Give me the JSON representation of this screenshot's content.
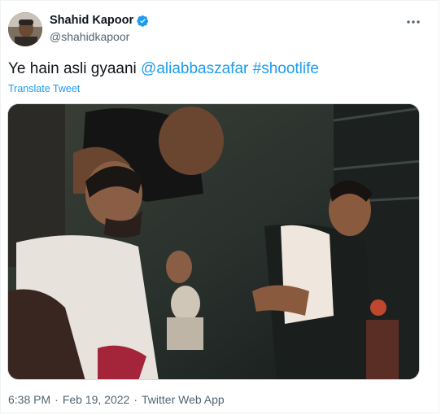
{
  "author": {
    "display_name": "Shahid Kapoor",
    "handle": "@shahidkapoor",
    "verified": true
  },
  "tweet": {
    "text_plain": "Ye hain asli gyaani ",
    "mentions": [
      "@aliabbaszafar"
    ],
    "hashtags": [
      "#shootlife"
    ],
    "translate_label": "Translate Tweet"
  },
  "media": {
    "type": "photo",
    "alt": "",
    "icon": "photo"
  },
  "meta": {
    "time": "6:38 PM",
    "separator": "·",
    "date": "Feb 19, 2022",
    "source": "Twitter Web App"
  },
  "colors": {
    "link": "#1d9bf0",
    "verified_badge": "#1d9bf0",
    "secondary_text": "#536471",
    "primary_text": "#0f1419"
  },
  "icons": [
    "avatar",
    "verified-badge-icon",
    "more-options-icon"
  ]
}
